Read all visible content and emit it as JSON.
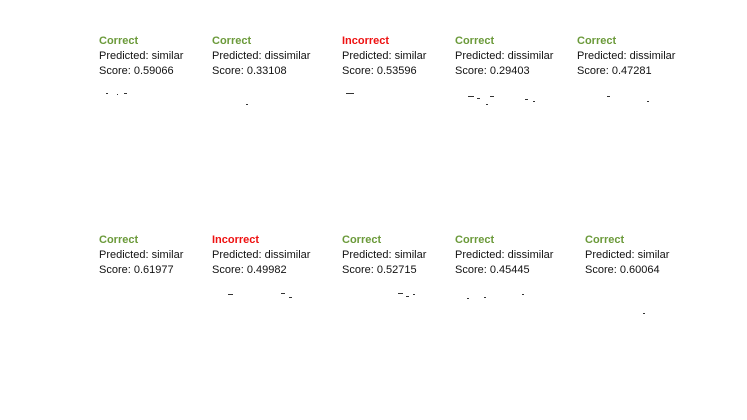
{
  "labels": {
    "predicted_prefix": "Predicted: ",
    "score_prefix": "Score: "
  },
  "colors": {
    "correct": "#6b9a3a",
    "incorrect": "#ee1111"
  },
  "results": [
    {
      "verdict": "Correct",
      "predicted": "similar",
      "score": "0.59066"
    },
    {
      "verdict": "Correct",
      "predicted": "dissimilar",
      "score": "0.33108"
    },
    {
      "verdict": "Incorrect",
      "predicted": "similar",
      "score": "0.53596"
    },
    {
      "verdict": "Correct",
      "predicted": "dissimilar",
      "score": "0.29403"
    },
    {
      "verdict": "Correct",
      "predicted": "dissimilar",
      "score": "0.47281"
    },
    {
      "verdict": "Correct",
      "predicted": "similar",
      "score": "0.61977"
    },
    {
      "verdict": "Incorrect",
      "predicted": "dissimilar",
      "score": "0.49982"
    },
    {
      "verdict": "Correct",
      "predicted": "similar",
      "score": "0.52715"
    },
    {
      "verdict": "Correct",
      "predicted": "dissimilar",
      "score": "0.45445"
    },
    {
      "verdict": "Correct",
      "predicted": "similar",
      "score": "0.60064"
    }
  ]
}
